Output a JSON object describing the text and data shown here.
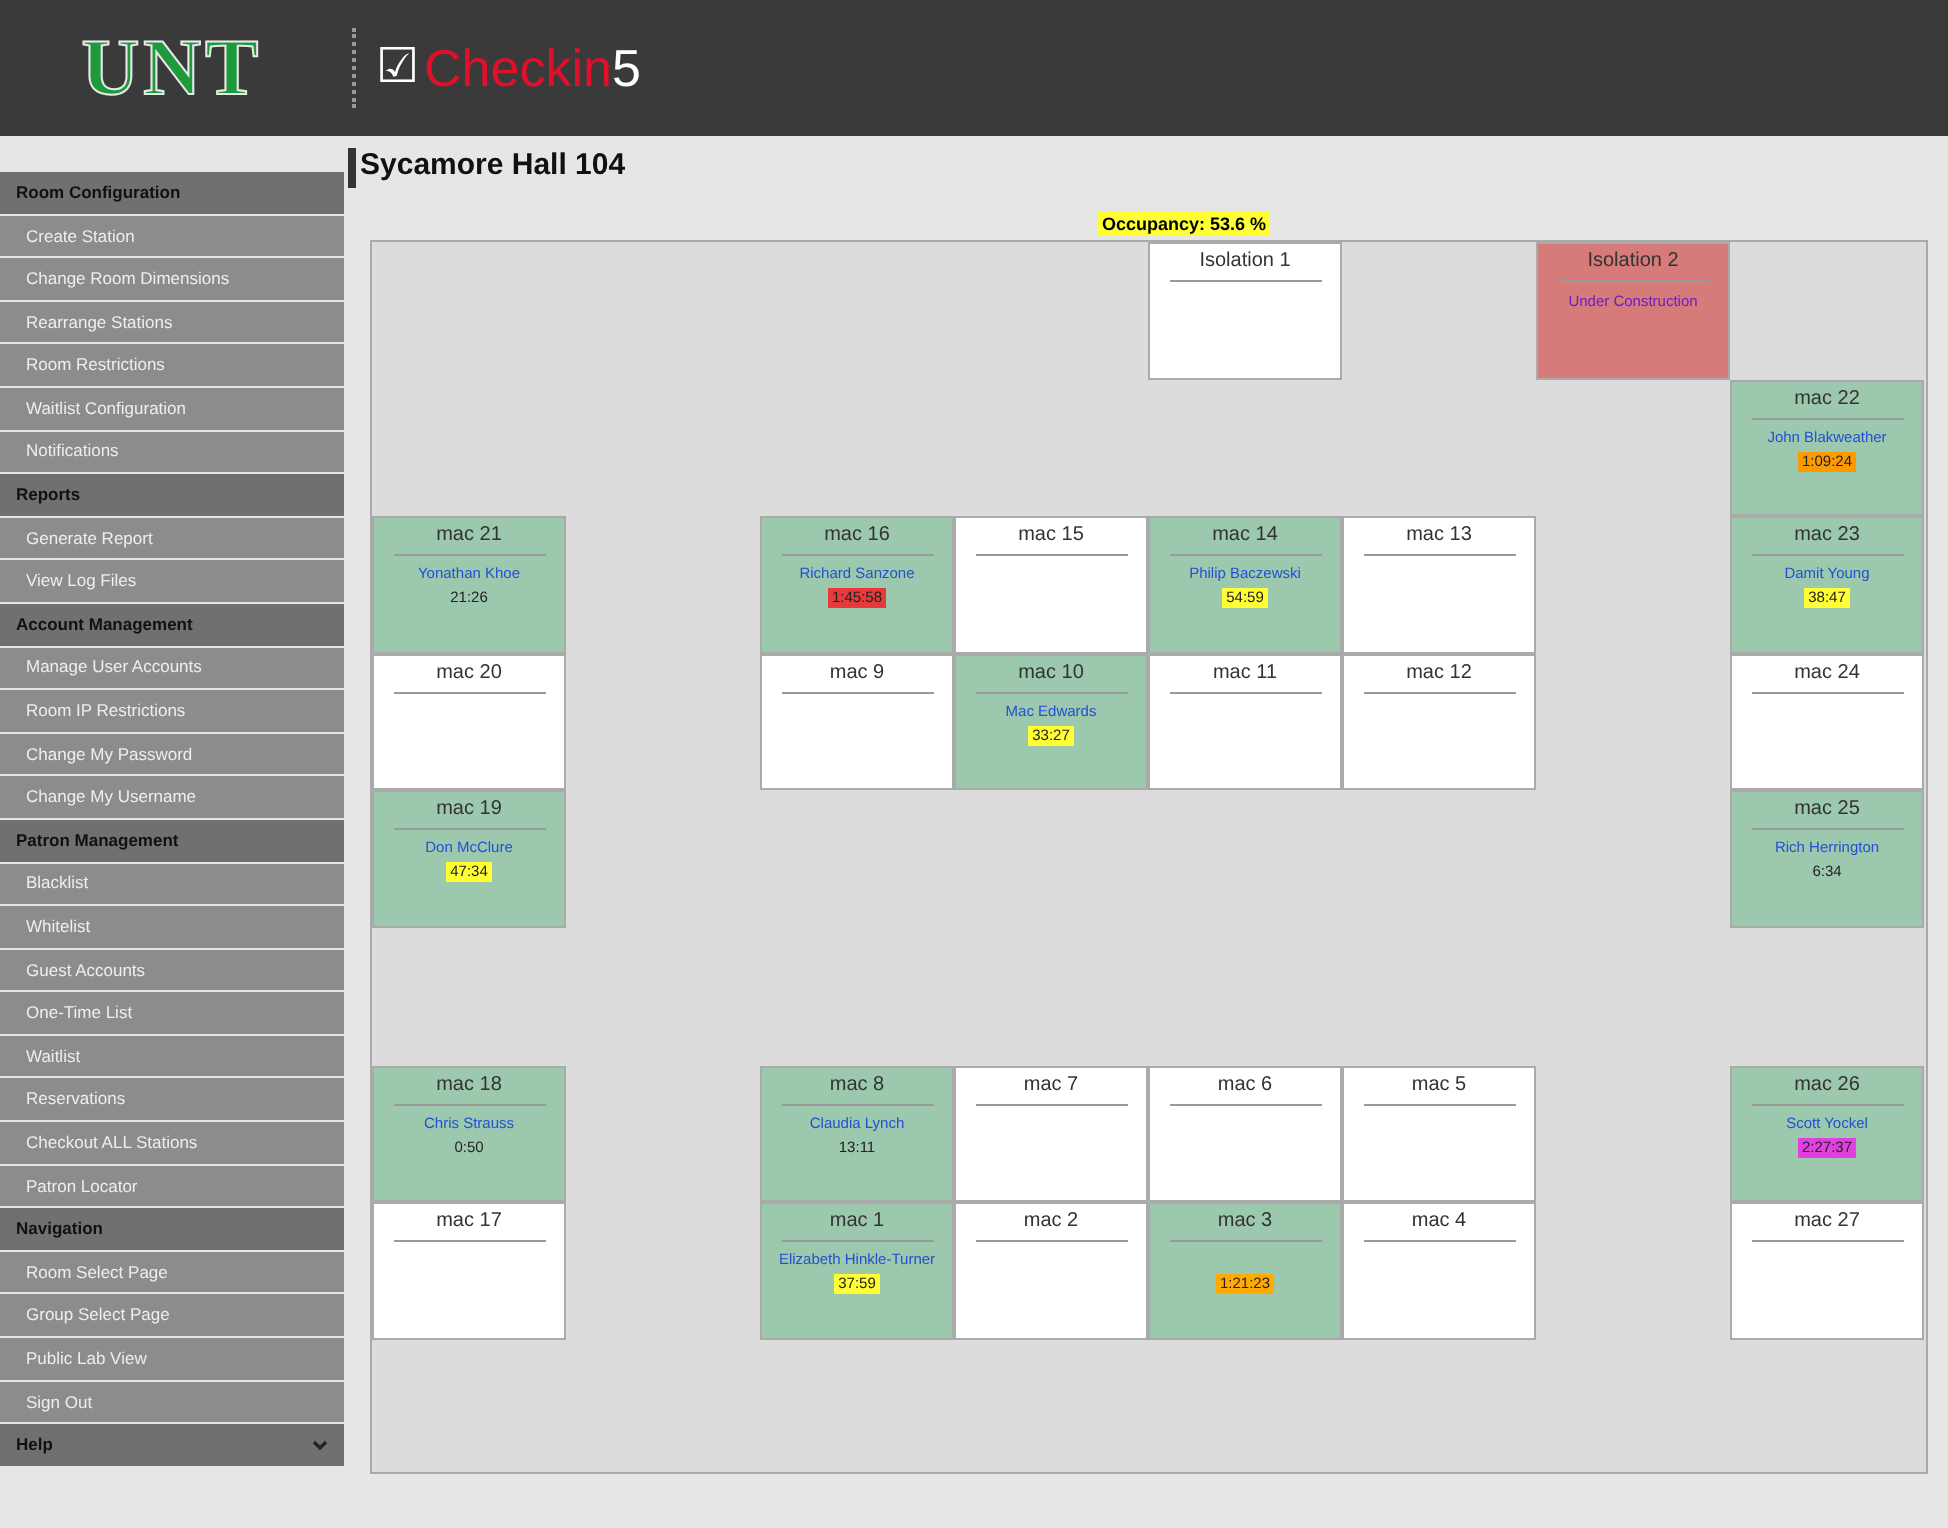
{
  "header": {
    "logo": "UNT",
    "app_mark": "☑",
    "app_name": "Checkin",
    "app_version": "5"
  },
  "sidebar": [
    {
      "title": "Room Configuration",
      "items": [
        "Create Station",
        "Change Room Dimensions",
        "Rearrange Stations",
        "Room Restrictions",
        "Waitlist Configuration",
        "Notifications"
      ]
    },
    {
      "title": "Reports",
      "items": [
        "Generate Report",
        "View Log Files"
      ]
    },
    {
      "title": "Account Management",
      "items": [
        "Manage User Accounts",
        "Room IP Restrictions",
        "Change My Password",
        "Change My Username"
      ]
    },
    {
      "title": "Patron Management",
      "items": [
        "Blacklist",
        "Whitelist",
        "Guest Accounts",
        "One-Time List",
        "Waitlist",
        "Reservations",
        "Checkout ALL Stations",
        "Patron Locator"
      ]
    },
    {
      "title": "Navigation",
      "items": [
        "Room Select Page",
        "Group Select Page",
        "Public Lab View",
        "Sign Out"
      ]
    },
    {
      "title": "Help"
    }
  ],
  "room": {
    "title": "Sycamore Hall 104",
    "occupancy": "Occupancy: 53.6 %",
    "stations": [
      {
        "label": "Isolation 1",
        "kind": "free"
      },
      {
        "label": "Isolation 2",
        "kind": "closed",
        "note": "Under Construction"
      },
      {
        "label": "mac 22",
        "kind": "occupied",
        "user": "John Blakweather",
        "time": "1:09:24",
        "color": "#ff9900"
      },
      {
        "label": "mac 21",
        "kind": "occupied",
        "user": "Yonathan Khoe",
        "time": "21:26"
      },
      {
        "label": "mac 16",
        "kind": "occupied",
        "user": "Richard Sanzone",
        "time": "1:45:58",
        "color": "#e83a3a"
      },
      {
        "label": "mac 15",
        "kind": "free"
      },
      {
        "label": "mac 14",
        "kind": "occupied",
        "user": "Philip Baczewski",
        "time": "54:59",
        "color": "#ffff33"
      },
      {
        "label": "mac 13",
        "kind": "free"
      },
      {
        "label": "mac 23",
        "kind": "occupied",
        "user": "Damit Young",
        "time": "38:47",
        "color": "#ffff33"
      },
      {
        "label": "mac 20",
        "kind": "free"
      },
      {
        "label": "mac 9",
        "kind": "free"
      },
      {
        "label": "mac 10",
        "kind": "occupied",
        "user": "Mac Edwards",
        "time": "33:27",
        "color": "#ffff33"
      },
      {
        "label": "mac 11",
        "kind": "free"
      },
      {
        "label": "mac 12",
        "kind": "free"
      },
      {
        "label": "mac 24",
        "kind": "free"
      },
      {
        "label": "mac 19",
        "kind": "occupied",
        "user": "Don McClure",
        "time": "47:34",
        "color": "#ffff33"
      },
      {
        "label": "mac 25",
        "kind": "occupied",
        "user": "Rich Herrington",
        "time": "6:34"
      },
      {
        "label": "mac 18",
        "kind": "occupied",
        "user": "Chris Strauss",
        "time": "0:50"
      },
      {
        "label": "mac 8",
        "kind": "occupied",
        "user": "Claudia Lynch",
        "time": "13:11"
      },
      {
        "label": "mac 7",
        "kind": "free"
      },
      {
        "label": "mac 6",
        "kind": "free"
      },
      {
        "label": "mac 5",
        "kind": "free"
      },
      {
        "label": "mac 26",
        "kind": "occupied",
        "user": "Scott Yockel",
        "time": "2:27:37",
        "color": "#e040e0"
      },
      {
        "label": "mac 17",
        "kind": "free"
      },
      {
        "label": "mac 1",
        "kind": "occupied",
        "user": "Elizabeth Hinkle-Turner",
        "time": "37:59",
        "color": "#ffff33"
      },
      {
        "label": "mac 2",
        "kind": "free"
      },
      {
        "label": "mac 3",
        "kind": "occupied",
        "time": "1:21:23",
        "color": "#ffaa00"
      },
      {
        "label": "mac 4",
        "kind": "free"
      },
      {
        "label": "mac 27",
        "kind": "free"
      }
    ]
  }
}
